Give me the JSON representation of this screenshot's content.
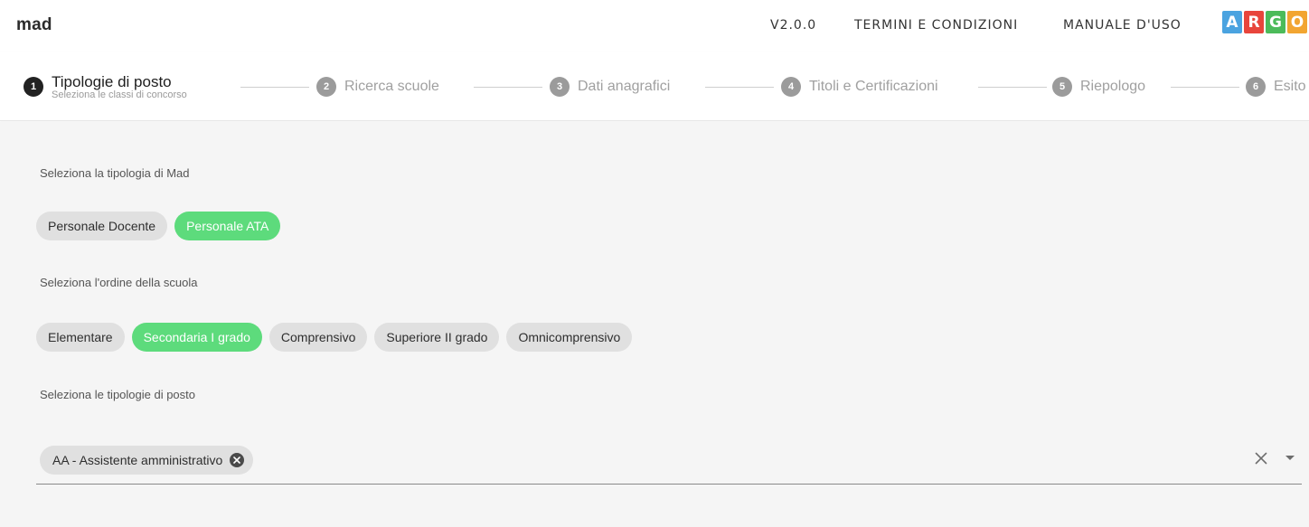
{
  "header": {
    "app_title": "mad",
    "version": "V2.0.0",
    "terms_link": "TERMINI E CONDIZIONI",
    "manual_link": "MANUALE D'USO",
    "logo": {
      "letters": [
        "A",
        "R",
        "G",
        "O"
      ],
      "colors": [
        "#4aa3e0",
        "#e8453c",
        "#4cbb5a",
        "#f2a531"
      ]
    }
  },
  "stepper": {
    "steps": [
      {
        "number": "1",
        "label": "Tipologie di posto",
        "sublabel": "Seleziona le classi di concorso",
        "active": true
      },
      {
        "number": "2",
        "label": "Ricerca scuole",
        "active": false
      },
      {
        "number": "3",
        "label": "Dati anagrafici",
        "active": false
      },
      {
        "number": "4",
        "label": "Titoli e Certificazioni",
        "active": false
      },
      {
        "number": "5",
        "label": "Riepologo",
        "active": false
      },
      {
        "number": "6",
        "label": "Esito",
        "active": false
      }
    ]
  },
  "form": {
    "mad_type_label": "Seleziona la tipologia di Mad",
    "mad_types": [
      {
        "label": "Personale Docente",
        "selected": false
      },
      {
        "label": "Personale ATA",
        "selected": true
      }
    ],
    "school_order_label": "Seleziona l'ordine della scuola",
    "school_orders": [
      {
        "label": "Elementare",
        "selected": false
      },
      {
        "label": "Secondaria I grado",
        "selected": true
      },
      {
        "label": "Comprensivo",
        "selected": false
      },
      {
        "label": "Superiore II grado",
        "selected": false
      },
      {
        "label": "Omnicomprensivo",
        "selected": false
      }
    ],
    "post_types_label": "Seleziona le tipologie di posto",
    "selected_post_types": [
      "AA - Assistente amministrativo"
    ]
  },
  "colors": {
    "selected_chip": "#5ddb7c",
    "chip": "#e0e0e0",
    "background": "#f5f5f5"
  },
  "icons": {
    "chip_delete": "cancel-icon",
    "clear": "close-icon",
    "dropdown": "arrow-drop-down-icon"
  }
}
